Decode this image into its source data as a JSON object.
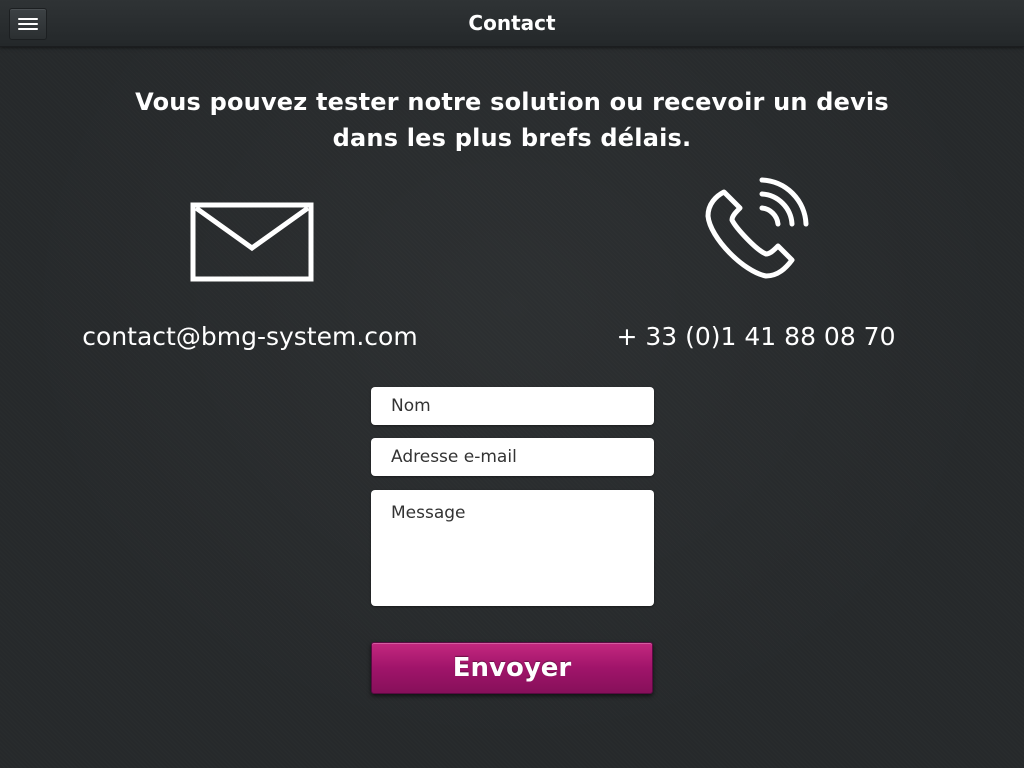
{
  "header": {
    "title": "Contact",
    "menu_icon": "hamburger-menu-icon"
  },
  "headline": {
    "line1": "Vous pouvez tester notre solution ou recevoir un devis",
    "line2": "dans les plus brefs délais."
  },
  "contact": {
    "email_icon": "envelope-icon",
    "phone_icon": "phone-icon",
    "email": "contact@bmg-system.com",
    "phone": "+ 33 (0)1 41 88 08 70"
  },
  "form": {
    "name_placeholder": "Nom",
    "email_placeholder": "Adresse e-mail",
    "message_placeholder": "Message",
    "submit_label": "Envoyer"
  },
  "colors": {
    "background": "#26292b",
    "accent": "#a0146a",
    "text": "#ffffff"
  }
}
